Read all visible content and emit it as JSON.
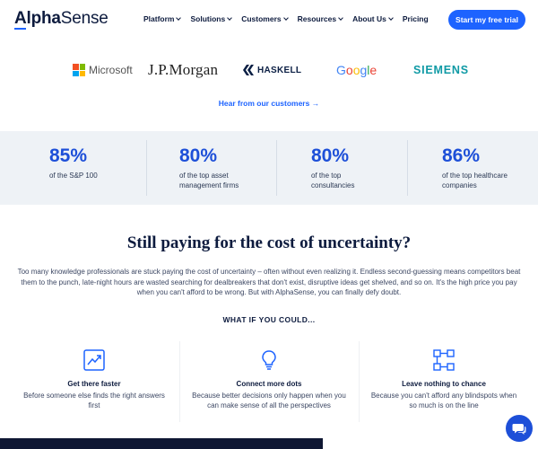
{
  "header": {
    "logo_part1": "Alpha",
    "logo_part2": "Sense",
    "nav": [
      {
        "label": "Platform",
        "dropdown": true
      },
      {
        "label": "Solutions",
        "dropdown": true
      },
      {
        "label": "Customers",
        "dropdown": true
      },
      {
        "label": "Resources",
        "dropdown": true
      },
      {
        "label": "About Us",
        "dropdown": true
      },
      {
        "label": "Pricing",
        "dropdown": false
      }
    ],
    "cta_label": "Start my free trial"
  },
  "logos": {
    "microsoft": "Microsoft",
    "jpmorgan": "J.P.Morgan",
    "haskell": "HASKELL",
    "google": [
      "G",
      "o",
      "o",
      "g",
      "l",
      "e"
    ],
    "siemens": "SIEMENS"
  },
  "hear_link": "Hear from our customers →",
  "stats": [
    {
      "value": "85%",
      "desc_line1": "of the S&P 100",
      "desc_line2": ""
    },
    {
      "value": "80%",
      "desc_line1": "of the top asset",
      "desc_line2": "management firms"
    },
    {
      "value": "80%",
      "desc_line1": "of the top",
      "desc_line2": "consultancies"
    },
    {
      "value": "86%",
      "desc_line1": "of the top healthcare",
      "desc_line2": "companies"
    }
  ],
  "section": {
    "heading": "Still paying for the cost of uncertainty?",
    "paragraph": "Too many knowledge professionals are stuck paying the cost of uncertainty – often without even realizing it. Endless second-guessing means competitors beat them to the punch, late-night hours are wasted searching for dealbreakers that don't exist, disruptive ideas get shelved, and so on. It's the high price you pay when you can't afford to be wrong. But with AlphaSense, you can finally defy doubt.",
    "what_if": "WHAT IF YOU COULD..."
  },
  "features": [
    {
      "icon": "trend-chart-icon",
      "title": "Get there faster",
      "desc_line1": "Before someone else finds the right answers",
      "desc_line2": "first"
    },
    {
      "icon": "lightbulb-icon",
      "title": "Connect more dots",
      "desc_line1": "Because better decisions only happen when you",
      "desc_line2": "can make sense of all the perspectives"
    },
    {
      "icon": "flowchart-icon",
      "title": "Leave nothing to chance",
      "desc_line1": "Because you can't afford any blindspots when",
      "desc_line2": "so much is on the line"
    }
  ],
  "colors": {
    "accent": "#1d63ff",
    "stat_number": "#1d4fd8",
    "navy": "#0d1b3e",
    "stats_bg": "#eef2f6",
    "siemens_teal": "#0f9aa5"
  },
  "chat_icon": "chat-bubble-icon"
}
